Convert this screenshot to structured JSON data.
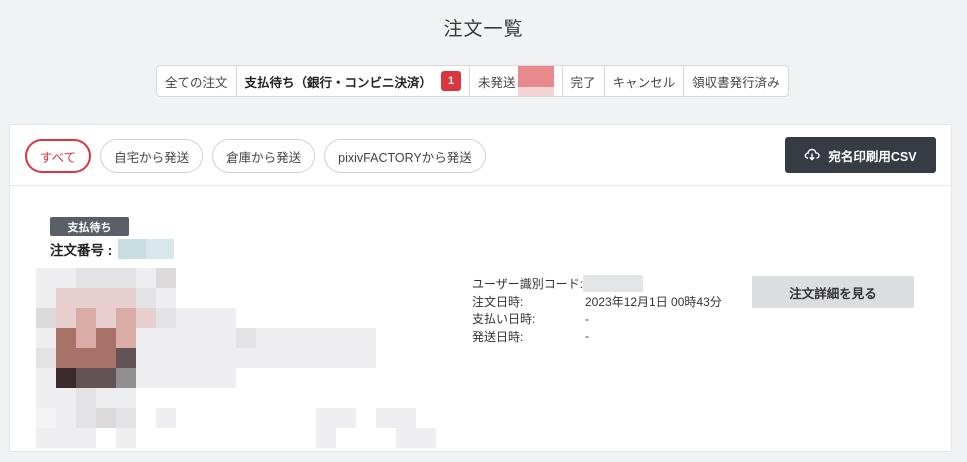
{
  "page": {
    "title": "注文一覧"
  },
  "status_tabs": [
    {
      "label": "全ての注文"
    },
    {
      "label": "支払待ち（銀行・コンビニ決済）",
      "badge": "1"
    },
    {
      "label": "未発送"
    },
    {
      "label": "完了"
    },
    {
      "label": "キャンセル"
    },
    {
      "label": "領収書発行済み"
    }
  ],
  "filters": [
    {
      "label": "すべて"
    },
    {
      "label": "自宅から発送"
    },
    {
      "label": "倉庫から発送"
    },
    {
      "label": "pixivFACTORYから発送"
    }
  ],
  "csv_button": {
    "label": "宛名印刷用CSV",
    "icon": "cloud-download-icon"
  },
  "order": {
    "status": "支払待ち",
    "number_label": "注文番号 :",
    "info": [
      {
        "label": "ユーザー識別コード:",
        "value": ""
      },
      {
        "label": "注文日時:",
        "value": "2023年12月1日 00時43分"
      },
      {
        "label": "支払い日時:",
        "value": "-"
      },
      {
        "label": "発送日時:",
        "value": "-"
      }
    ],
    "detail_button": "注文詳細を見る"
  },
  "colors": {
    "accent_red": "#d9363e",
    "dark_button": "#363b44",
    "background": "#f1f2f4"
  }
}
